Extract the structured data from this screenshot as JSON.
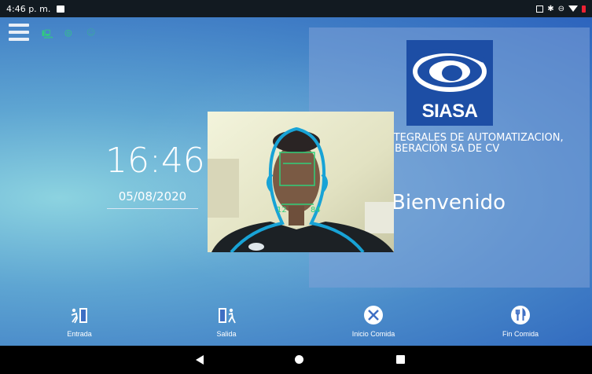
{
  "status_bar": {
    "time": "4:46 p. m."
  },
  "clock": {
    "time": "16:46",
    "date": "05/08/2020"
  },
  "brand": {
    "logo_text": "SIASA",
    "company_line1": "NTEGRALES DE AUTOMATIZACIÓN,",
    "company_line2": "LIBERACIÓN SA DE CV",
    "welcome": "Bienvenido"
  },
  "camera": {
    "tag_left": "12",
    "tag_right": "84"
  },
  "actions": [
    {
      "label": "Entrada",
      "icon": "enter-door-icon"
    },
    {
      "label": "Salida",
      "icon": "exit-door-icon"
    },
    {
      "label": "Inicio Comida",
      "icon": "meal-start-icon"
    },
    {
      "label": "Fin Comida",
      "icon": "meal-end-icon"
    }
  ],
  "colors": {
    "accent_green": "#2fd07a",
    "logo_blue": "#1d4ea5",
    "face_outline": "#18a3d6"
  }
}
